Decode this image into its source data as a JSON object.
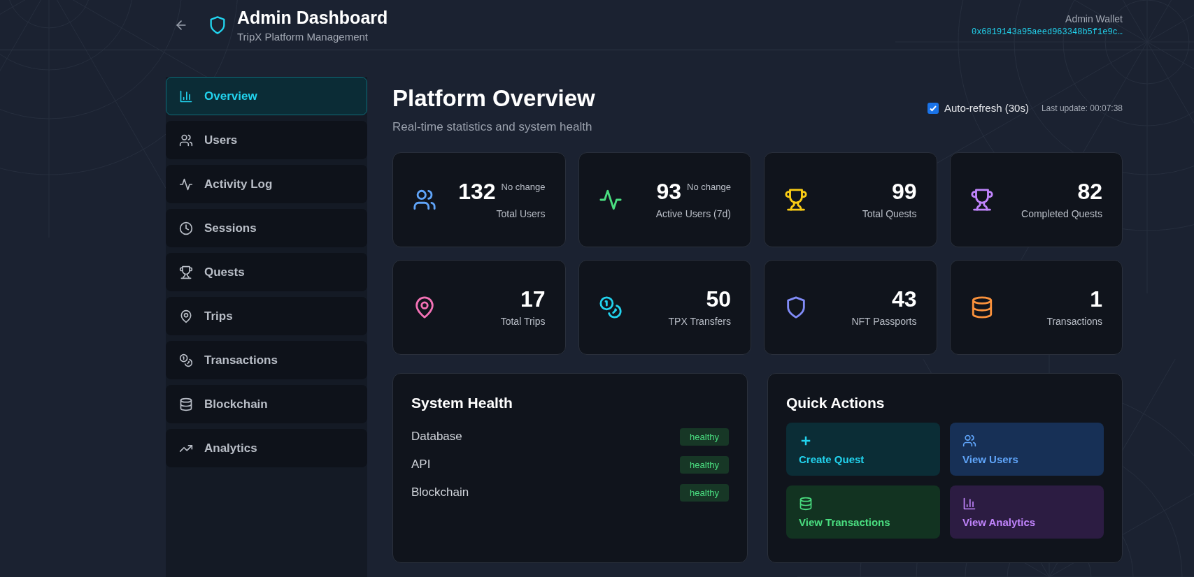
{
  "header": {
    "title": "Admin Dashboard",
    "subtitle": "TripX Platform Management",
    "wallet_label": "Admin Wallet",
    "wallet_address": "0x6819143a95aeed963348b5f1e9c…"
  },
  "sidebar": {
    "items": [
      {
        "label": "Overview",
        "selected": true
      },
      {
        "label": "Users",
        "selected": false
      },
      {
        "label": "Activity Log",
        "selected": false
      },
      {
        "label": "Sessions",
        "selected": false
      },
      {
        "label": "Quests",
        "selected": false
      },
      {
        "label": "Trips",
        "selected": false
      },
      {
        "label": "Transactions",
        "selected": false
      },
      {
        "label": "Blockchain",
        "selected": false
      },
      {
        "label": "Analytics",
        "selected": false
      }
    ]
  },
  "page": {
    "title": "Platform Overview",
    "subtitle": "Real-time statistics and system health",
    "auto_refresh": {
      "label": "Auto-refresh (30s)",
      "checked": true
    },
    "last_update": "Last update: 00:07:38"
  },
  "stats": [
    {
      "value": "132",
      "change": "No change",
      "label": "Total Users",
      "color": "#60a5fa"
    },
    {
      "value": "93",
      "change": "No change",
      "label": "Active Users (7d)",
      "color": "#4ade80"
    },
    {
      "value": "99",
      "label": "Total Quests",
      "color": "#facc15"
    },
    {
      "value": "82",
      "label": "Completed Quests",
      "color": "#c084fc"
    },
    {
      "value": "17",
      "label": "Total Trips",
      "color": "#f472b6"
    },
    {
      "value": "50",
      "label": "TPX Transfers",
      "color": "#22d3ee"
    },
    {
      "value": "43",
      "label": "NFT Passports",
      "color": "#818cf8"
    },
    {
      "value": "1",
      "label": "Transactions",
      "color": "#fb923c"
    }
  ],
  "system_health": {
    "title": "System Health",
    "services": [
      {
        "name": "Database",
        "status": "healthy"
      },
      {
        "name": "API",
        "status": "healthy"
      },
      {
        "name": "Blockchain",
        "status": "healthy"
      }
    ]
  },
  "quick_actions": {
    "title": "Quick Actions",
    "actions": [
      {
        "label": "Create Quest",
        "color": "#22d3ee"
      },
      {
        "label": "View Users",
        "color": "#60a5fa"
      },
      {
        "label": "View Transactions",
        "color": "#4ade80"
      },
      {
        "label": "View Analytics",
        "color": "#c084fc"
      }
    ]
  }
}
